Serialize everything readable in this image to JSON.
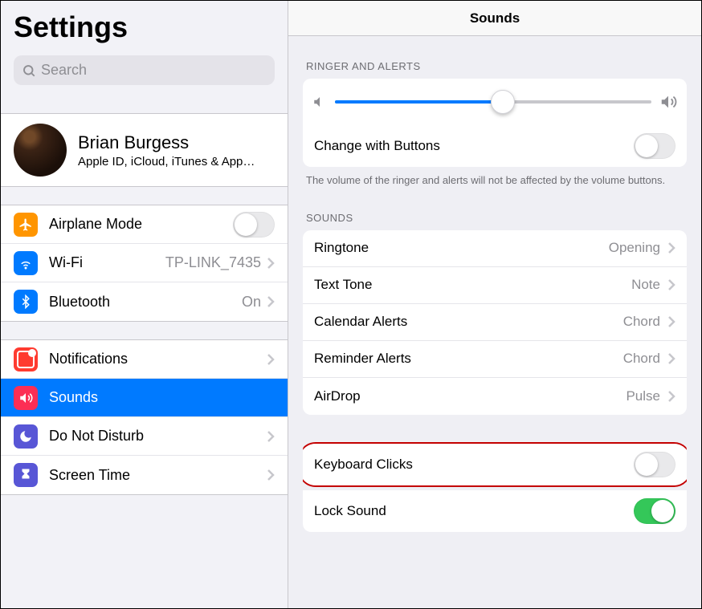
{
  "sidebar": {
    "title": "Settings",
    "search_placeholder": "Search",
    "profile": {
      "name": "Brian Burgess",
      "subtitle": "Apple ID, iCloud, iTunes & App…"
    },
    "airplane": {
      "label": "Airplane Mode"
    },
    "wifi": {
      "label": "Wi-Fi",
      "value": "TP-LINK_7435"
    },
    "bluetooth": {
      "label": "Bluetooth",
      "value": "On"
    },
    "notifications": {
      "label": "Notifications"
    },
    "sounds": {
      "label": "Sounds"
    },
    "dnd": {
      "label": "Do Not Disturb"
    },
    "screentime": {
      "label": "Screen Time"
    }
  },
  "detail": {
    "title": "Sounds",
    "ringer_section": "RINGER AND ALERTS",
    "slider_percent": 53,
    "change_buttons": "Change with Buttons",
    "change_buttons_footer": "The volume of the ringer and alerts will not be affected by the volume buttons.",
    "sounds_section": "SOUNDS",
    "ringtone": {
      "label": "Ringtone",
      "value": "Opening"
    },
    "texttone": {
      "label": "Text Tone",
      "value": "Note"
    },
    "calendar": {
      "label": "Calendar Alerts",
      "value": "Chord"
    },
    "reminder": {
      "label": "Reminder Alerts",
      "value": "Chord"
    },
    "airdrop": {
      "label": "AirDrop",
      "value": "Pulse"
    },
    "keyboard_clicks": "Keyboard Clicks",
    "lock_sound": "Lock Sound"
  }
}
